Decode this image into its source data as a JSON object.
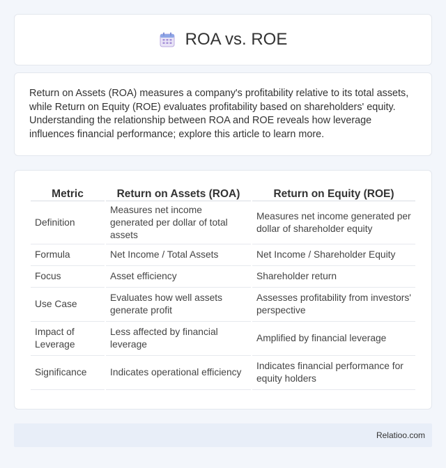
{
  "header": {
    "icon": "calendar-icon",
    "title": "ROA vs. ROE"
  },
  "intro": {
    "text": "Return on Assets (ROA) measures a company's profitability relative to its total assets, while Return on Equity (ROE) evaluates profitability based on shareholders' equity. Understanding the relationship between ROA and ROE reveals how leverage influences financial performance; explore this article to learn more."
  },
  "table": {
    "headers": [
      "Metric",
      "Return on Assets (ROA)",
      "Return on Equity (ROE)"
    ],
    "rows": [
      [
        "Definition",
        "Measures net income generated per dollar of total assets",
        "Measures net income generated per dollar of shareholder equity"
      ],
      [
        "Formula",
        "Net Income / Total Assets",
        "Net Income / Shareholder Equity"
      ],
      [
        "Focus",
        "Asset efficiency",
        "Shareholder return"
      ],
      [
        "Use Case",
        "Evaluates how well assets generate profit",
        "Assesses profitability from investors' perspective"
      ],
      [
        "Impact of Leverage",
        "Less affected by financial leverage",
        "Amplified by financial leverage"
      ],
      [
        "Significance",
        "Indicates operational efficiency",
        "Indicates financial performance for equity holders"
      ]
    ]
  },
  "footer": {
    "brand": "Relatioo.com"
  },
  "colors": {
    "background": "#f3f6fb",
    "card": "#ffffff",
    "footer": "#e8eef8",
    "icon_accent": "#8e7cc3"
  }
}
